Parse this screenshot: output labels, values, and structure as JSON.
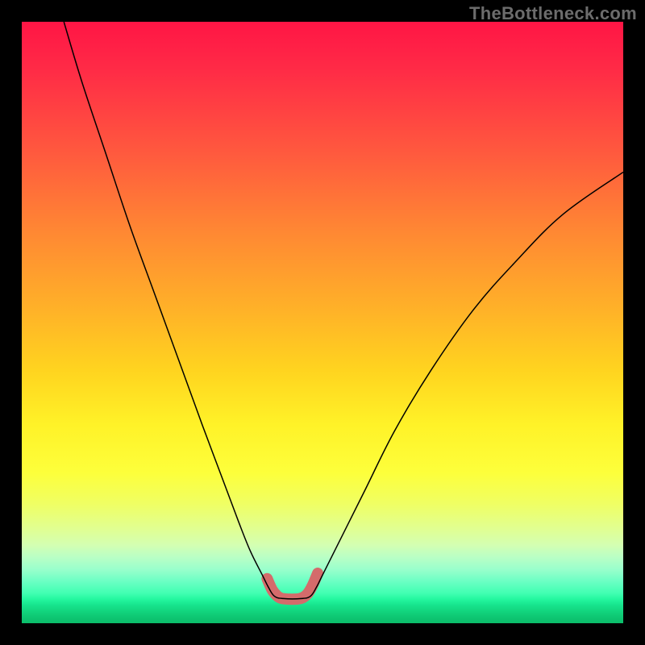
{
  "watermark": "TheBottleneck.com",
  "chart_data": {
    "type": "line",
    "title": "",
    "xlabel": "",
    "ylabel": "",
    "xlim": [
      0,
      100
    ],
    "ylim": [
      0,
      100
    ],
    "grid": false,
    "series": [
      {
        "name": "main-curve",
        "color": "#000000",
        "stroke_width": 1.5,
        "x": [
          7,
          10,
          14,
          18,
          22,
          26,
          30,
          33,
          36,
          38,
          40,
          41,
          42,
          43.5,
          46.5,
          48,
          49,
          50,
          53,
          57,
          62,
          68,
          75,
          82,
          90,
          100
        ],
        "values": [
          100,
          90,
          78,
          66,
          55,
          44,
          33,
          25,
          17,
          12,
          8,
          6,
          4.5,
          4.1,
          4.1,
          4.5,
          6,
          8,
          14,
          22,
          32,
          42,
          52,
          60,
          68,
          75
        ]
      },
      {
        "name": "marked-flat-region",
        "color": "#d46b6b",
        "stroke_width": 14,
        "linecap": "round",
        "x": [
          40.8,
          41.6,
          42.4,
          43.1,
          43.8,
          44.5,
          45.3,
          46.0,
          46.8,
          47.6,
          48.4,
          49.2
        ],
        "values": [
          7.4,
          5.6,
          4.6,
          4.15,
          4.05,
          4.0,
          4.0,
          4.05,
          4.3,
          5.0,
          6.4,
          8.3
        ]
      }
    ],
    "background": "rainbow-gradient (red top to green bottom)",
    "annotations": []
  }
}
